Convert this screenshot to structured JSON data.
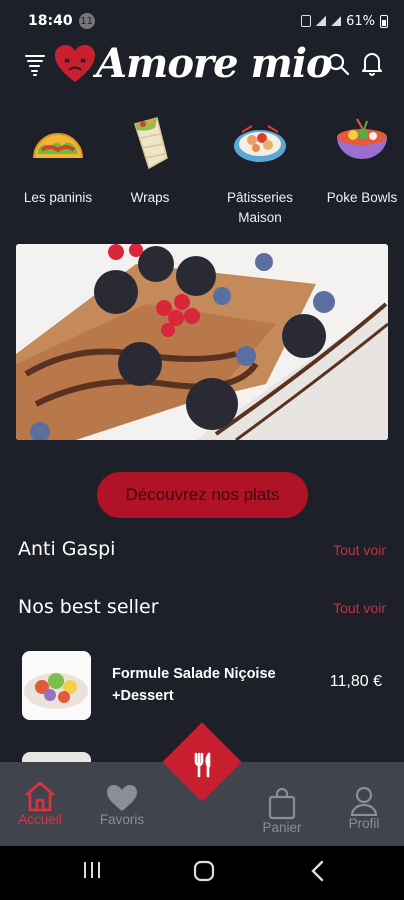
{
  "status": {
    "time": "18:40",
    "notif_count": "11",
    "battery": "61%"
  },
  "header": {
    "brand": "Amore mio"
  },
  "categories": [
    {
      "label": "Les paninis",
      "icon": "taco-icon"
    },
    {
      "label": "Wraps",
      "icon": "wrap-icon"
    },
    {
      "label": "Pâtisseries Maison",
      "icon": "pastry-plate-icon"
    },
    {
      "label": "Poke Bowls",
      "icon": "poke-bowl-icon"
    }
  ],
  "cta": {
    "label": "Découvrez nos plats"
  },
  "sections": {
    "anti_gaspi": {
      "title": "Anti Gaspi",
      "see_all": "Tout voir"
    },
    "best_seller": {
      "title": "Nos best seller",
      "see_all": "Tout voir"
    }
  },
  "products": [
    {
      "name": "Formule Salade Niçoise +Dessert",
      "price": "11,80 €"
    }
  ],
  "nav": {
    "home": "Accueil",
    "favorites": "Favoris",
    "cart": "Panier",
    "profile": "Profil"
  },
  "colors": {
    "background": "#1e2029",
    "accent": "#c9202f",
    "nav_bg": "#42444d"
  }
}
